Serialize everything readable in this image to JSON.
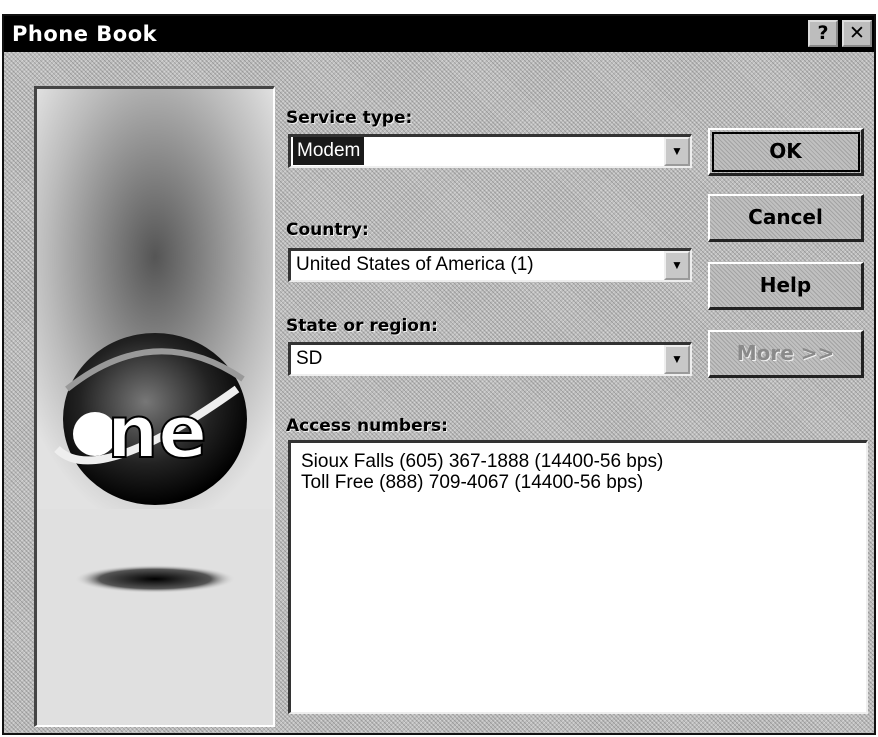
{
  "window": {
    "title": "Phone Book"
  },
  "title_buttons": {
    "help": "?",
    "close": "✕"
  },
  "service_type": {
    "label": "Service type:",
    "value": "Modem"
  },
  "country": {
    "label": "Country:",
    "value": "United States of America (1)"
  },
  "state": {
    "label": "State or region:",
    "value": "SD"
  },
  "access_numbers": {
    "label": "Access numbers:",
    "items": [
      "Sioux Falls (605) 367-1888 (14400-56 bps)",
      "Toll Free (888) 709-4067 (14400-56 bps)"
    ]
  },
  "buttons": {
    "ok": "OK",
    "cancel": "Cancel",
    "help": "Help",
    "more": "More >>"
  },
  "logo": {
    "text": "ne"
  },
  "dropdown_icon": "chevron-down-icon",
  "colors": {
    "titlebar": "#000000",
    "selection": "#1a1a1a",
    "dialog": "#bdbdbd"
  }
}
